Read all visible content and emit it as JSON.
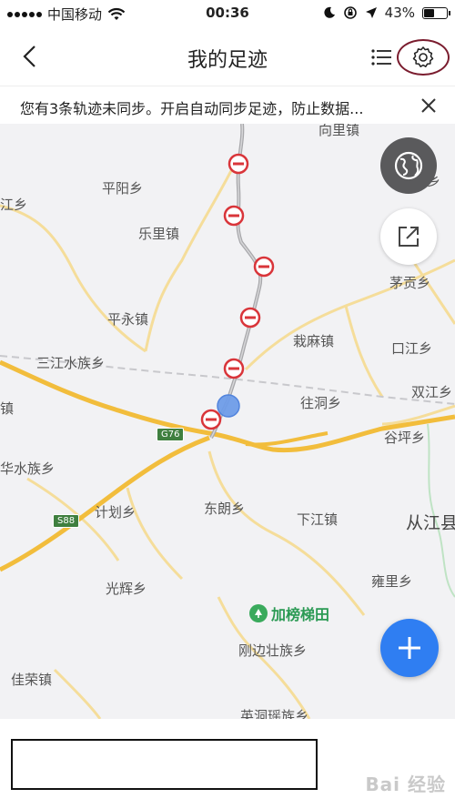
{
  "status_bar": {
    "carrier": "中国移动",
    "time": "00:36",
    "battery": "43%",
    "battery_level": 0.43
  },
  "header": {
    "title": "我的足迹"
  },
  "notice": {
    "text": "您有3条轨迹未同步。开启自动同步足迹，防止数据..."
  },
  "map": {
    "places": [
      {
        "name": "向里镇",
        "type": "town"
      },
      {
        "name": "平阳乡",
        "type": "town"
      },
      {
        "name": "江乡",
        "type": "town"
      },
      {
        "name": "乐里镇",
        "type": "town"
      },
      {
        "name": "茅贡乡",
        "type": "town"
      },
      {
        "name": "平永镇",
        "type": "town"
      },
      {
        "name": "栽麻镇",
        "type": "town"
      },
      {
        "name": "口江乡",
        "type": "town"
      },
      {
        "name": "三江水族乡",
        "type": "town"
      },
      {
        "name": "往洞乡",
        "type": "town"
      },
      {
        "name": "双江乡",
        "type": "town"
      },
      {
        "name": "镇",
        "type": "town"
      },
      {
        "name": "谷坪乡",
        "type": "town"
      },
      {
        "name": "华水族乡",
        "type": "town"
      },
      {
        "name": "计划乡",
        "type": "town"
      },
      {
        "name": "东朗乡",
        "type": "town"
      },
      {
        "name": "下江镇",
        "type": "town"
      },
      {
        "name": "从江县",
        "type": "county"
      },
      {
        "name": "光辉乡",
        "type": "town"
      },
      {
        "name": "雍里乡",
        "type": "town"
      },
      {
        "name": "刚边壮族乡",
        "type": "town"
      },
      {
        "name": "佳荣镇",
        "type": "town"
      },
      {
        "name": "英洞瑶族乡",
        "type": "town"
      },
      {
        "name": "夏乡",
        "type": "town"
      }
    ],
    "roads": [
      "G76",
      "S88"
    ],
    "poi": {
      "name": "加榜梯田"
    },
    "colors": {
      "highway": "#f2bd3c",
      "minor_road": "#f5dd9a",
      "track": "#b0b0b0",
      "marker": "#d9353a",
      "location": "#5b8ee6",
      "accent_blue": "#2f7ef2"
    }
  },
  "footer": {
    "watermark": "Bai 经验"
  }
}
